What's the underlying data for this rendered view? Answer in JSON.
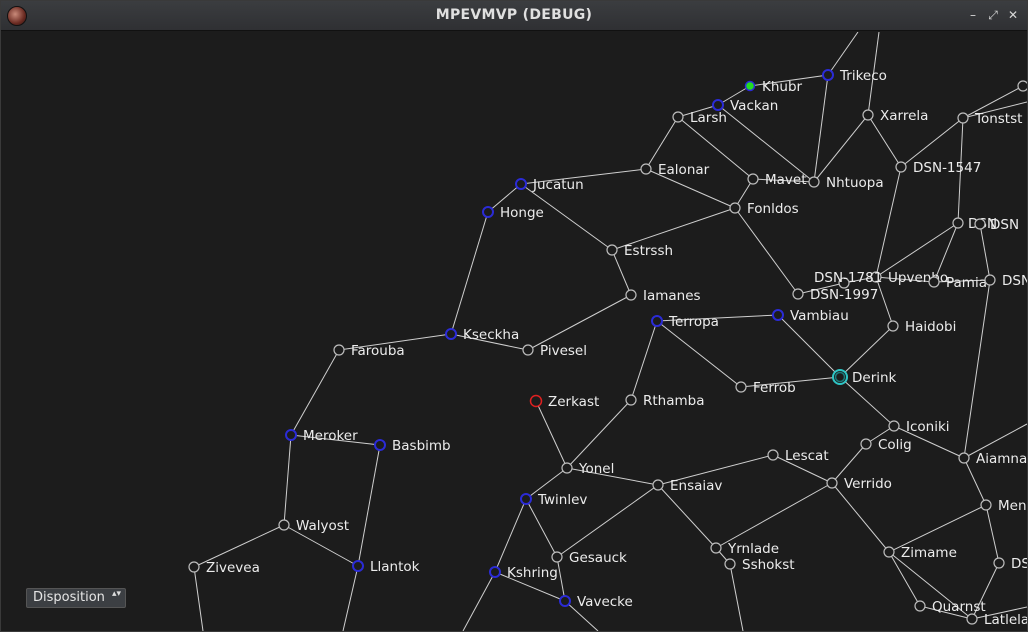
{
  "window": {
    "title": "MPEVMVP (DEBUG)",
    "buttons": {
      "minimize": "–",
      "maximize": "⤢",
      "close": "✕"
    }
  },
  "map": {
    "colors": {
      "default": "#bdbdbd",
      "blue": "#2b2bd6",
      "red": "#e02020",
      "green": "#22dd22",
      "selected": "#2ec4c4",
      "edge": "#cfcfcf",
      "label": "#ececec"
    },
    "nodes": [
      {
        "id": "khubr",
        "label": "Khubr",
        "status": "green"
      },
      {
        "id": "trikeco",
        "label": "Trikeco",
        "status": "blue"
      },
      {
        "id": "vackan",
        "label": "Vackan",
        "status": "blue"
      },
      {
        "id": "larsh",
        "label": "Larsh",
        "status": "default"
      },
      {
        "id": "xarrela",
        "label": "Xarrela",
        "status": "default"
      },
      {
        "id": "tonstst",
        "label": "Tonstst",
        "status": "default"
      },
      {
        "id": "ealonar",
        "label": "Ealonar",
        "status": "default"
      },
      {
        "id": "mavet",
        "label": "Mavet",
        "status": "default"
      },
      {
        "id": "nhtuopa",
        "label": "Nhtuopa",
        "status": "default"
      },
      {
        "id": "dsn1547",
        "label": "DSN-1547",
        "status": "default"
      },
      {
        "id": "jucatun",
        "label": "Jucatun",
        "status": "blue"
      },
      {
        "id": "honge",
        "label": "Honge",
        "status": "blue"
      },
      {
        "id": "fonldos",
        "label": "Fonldos",
        "status": "default"
      },
      {
        "id": "dsnright",
        "label": "DSN",
        "status": "default"
      },
      {
        "id": "estrssh",
        "label": "Estrssh",
        "status": "default"
      },
      {
        "id": "upvenbo",
        "label": "Upvenbo",
        "status": "default"
      },
      {
        "id": "dsn1781",
        "label": "DSN-1781",
        "status": "default"
      },
      {
        "id": "pamia",
        "label": "Pamia",
        "status": "default"
      },
      {
        "id": "dsnedge",
        "label": "DSN",
        "status": "default"
      },
      {
        "id": "iamanes",
        "label": "Iamanes",
        "status": "default"
      },
      {
        "id": "dsn1997",
        "label": "DSN-1997",
        "status": "default"
      },
      {
        "id": "terropa",
        "label": "Terropa",
        "status": "blue"
      },
      {
        "id": "vambiau",
        "label": "Vambiau",
        "status": "blue"
      },
      {
        "id": "haidobi",
        "label": "Haidobi",
        "status": "default"
      },
      {
        "id": "kseckha",
        "label": "Kseckha",
        "status": "blue"
      },
      {
        "id": "farouba",
        "label": "Farouba",
        "status": "default"
      },
      {
        "id": "pivesel",
        "label": "Pivesel",
        "status": "default"
      },
      {
        "id": "derink",
        "label": "Derink",
        "status": "selected"
      },
      {
        "id": "ferrob",
        "label": "Ferrob",
        "status": "default"
      },
      {
        "id": "zerkast",
        "label": "Zerkast",
        "status": "red"
      },
      {
        "id": "rthamba",
        "label": "Rthamba",
        "status": "default"
      },
      {
        "id": "iconiki",
        "label": "Iconiki",
        "status": "default"
      },
      {
        "id": "meroker",
        "label": "Meroker",
        "status": "blue"
      },
      {
        "id": "basbimb",
        "label": "Basbimb",
        "status": "blue"
      },
      {
        "id": "colig",
        "label": "Colig",
        "status": "default"
      },
      {
        "id": "aiamnar",
        "label": "Aiamnar",
        "status": "default"
      },
      {
        "id": "lescat",
        "label": "Lescat",
        "status": "default"
      },
      {
        "id": "yonel",
        "label": "Yonel",
        "status": "default"
      },
      {
        "id": "ensaiav",
        "label": "Ensaiav",
        "status": "default"
      },
      {
        "id": "verrido",
        "label": "Verrido",
        "status": "default"
      },
      {
        "id": "twinlev",
        "label": "Twinlev",
        "status": "blue"
      },
      {
        "id": "walyost",
        "label": "Walyost",
        "status": "default"
      },
      {
        "id": "mens",
        "label": "Mens",
        "status": "default"
      },
      {
        "id": "yrnlade",
        "label": "Yrnlade",
        "status": "default"
      },
      {
        "id": "zimame",
        "label": "Zimame",
        "status": "default"
      },
      {
        "id": "gesauck",
        "label": "Gesauck",
        "status": "default"
      },
      {
        "id": "sshokst",
        "label": "Sshokst",
        "status": "default"
      },
      {
        "id": "zivevea",
        "label": "Zivevea",
        "status": "default"
      },
      {
        "id": "llantok",
        "label": "Llantok",
        "status": "blue"
      },
      {
        "id": "ds",
        "label": "DS",
        "status": "default"
      },
      {
        "id": "kshring",
        "label": "Kshring",
        "status": "blue"
      },
      {
        "id": "vavecke",
        "label": "Vavecke",
        "status": "blue"
      },
      {
        "id": "quarnst",
        "label": "Quarnst",
        "status": "default"
      },
      {
        "id": "latlela",
        "label": "Latlela",
        "status": "default"
      },
      {
        "id": "dsnr2",
        "label": "DSN",
        "status": "default"
      },
      {
        "id": "dsnr3",
        "label": "DSN",
        "status": "default"
      }
    ]
  },
  "controls": {
    "disposition_label": "Disposition",
    "disposition_arrow": "▴▾"
  }
}
